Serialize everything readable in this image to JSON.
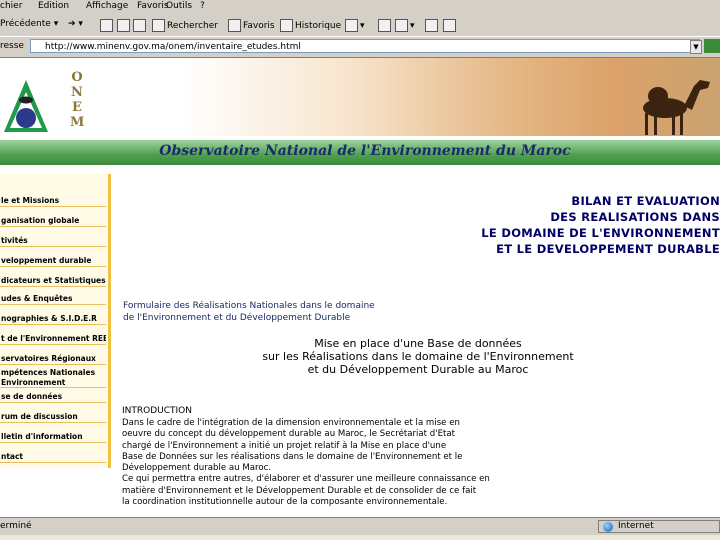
{
  "menu": [
    "chier",
    "Edition",
    "Affichage",
    "Favoris",
    "Outils",
    "?"
  ],
  "toolbar": {
    "back_label": "Précédente",
    "search_label": "Rechercher",
    "favorites_label": "Favoris",
    "history_label": "Historique"
  },
  "address": {
    "label": "resse",
    "url": "http://www.minenv.gov.ma/onem/inventaire_etudes.html"
  },
  "header": {
    "onem_letters": [
      "O",
      "N",
      "E",
      "M"
    ],
    "site_title": "Observatoire National de l'Environnement du Maroc"
  },
  "sidebar": {
    "items": [
      "le et Missions",
      "ganisation globale",
      "tivités",
      "veloppement durable",
      "dicateurs et Statistiques",
      "udes & Enquêtes",
      "nographies & S.I.D.E.R",
      "t de l'Environnement REEM",
      "servatoires Régionaux",
      "mpétences Nationales Environnement",
      "se de données",
      "rum de discussion",
      "lletin d'information",
      "ntact"
    ]
  },
  "main": {
    "heading_lines": [
      "BILAN ET EVALUATION",
      "DES REALISATIONS DANS",
      "LE DOMAINE DE L'ENVIRONNEMENT",
      "ET LE DEVELOPPEMENT DURABLE"
    ],
    "form_link_lines": [
      "Formulaire des Réalisations Nationales dans le domaine",
      "de l'Environnement et du Développement Durable"
    ],
    "subtitle_lines": [
      "Mise en place d'une Base de données",
      "sur les Réalisations dans le domaine de l'Environnement",
      "et du Développement Durable au Maroc"
    ],
    "intro_title": "INTRODUCTION",
    "intro_lines": [
      "Dans le cadre de l'intégration de la dimension environnementale et la mise en",
      "oeuvre du concept du développement durable au Maroc, le Secrétariat d'Etat",
      "chargé de l'Environnement a initié un projet relatif à la Mise en place d'une",
      "Base de Données sur les réalisations dans le domaine de l'Environnement et le",
      "Développement durable au Maroc.",
      "Ce qui permettra entre autres, d'élaborer et d'assurer une meilleure connaissance en",
      "matière d'Environnement et le Développement Durable et de consolider de ce fait",
      "la coordination institutionnelle autour de la composante environnementale."
    ]
  },
  "status": {
    "left": "erminé",
    "zone": "Internet"
  },
  "colors": {
    "title_blue": "#1a2a6a",
    "green_strip": "#4f9f4f",
    "sidebar_border": "#f0c040",
    "chrome": "#d4d0c8"
  }
}
